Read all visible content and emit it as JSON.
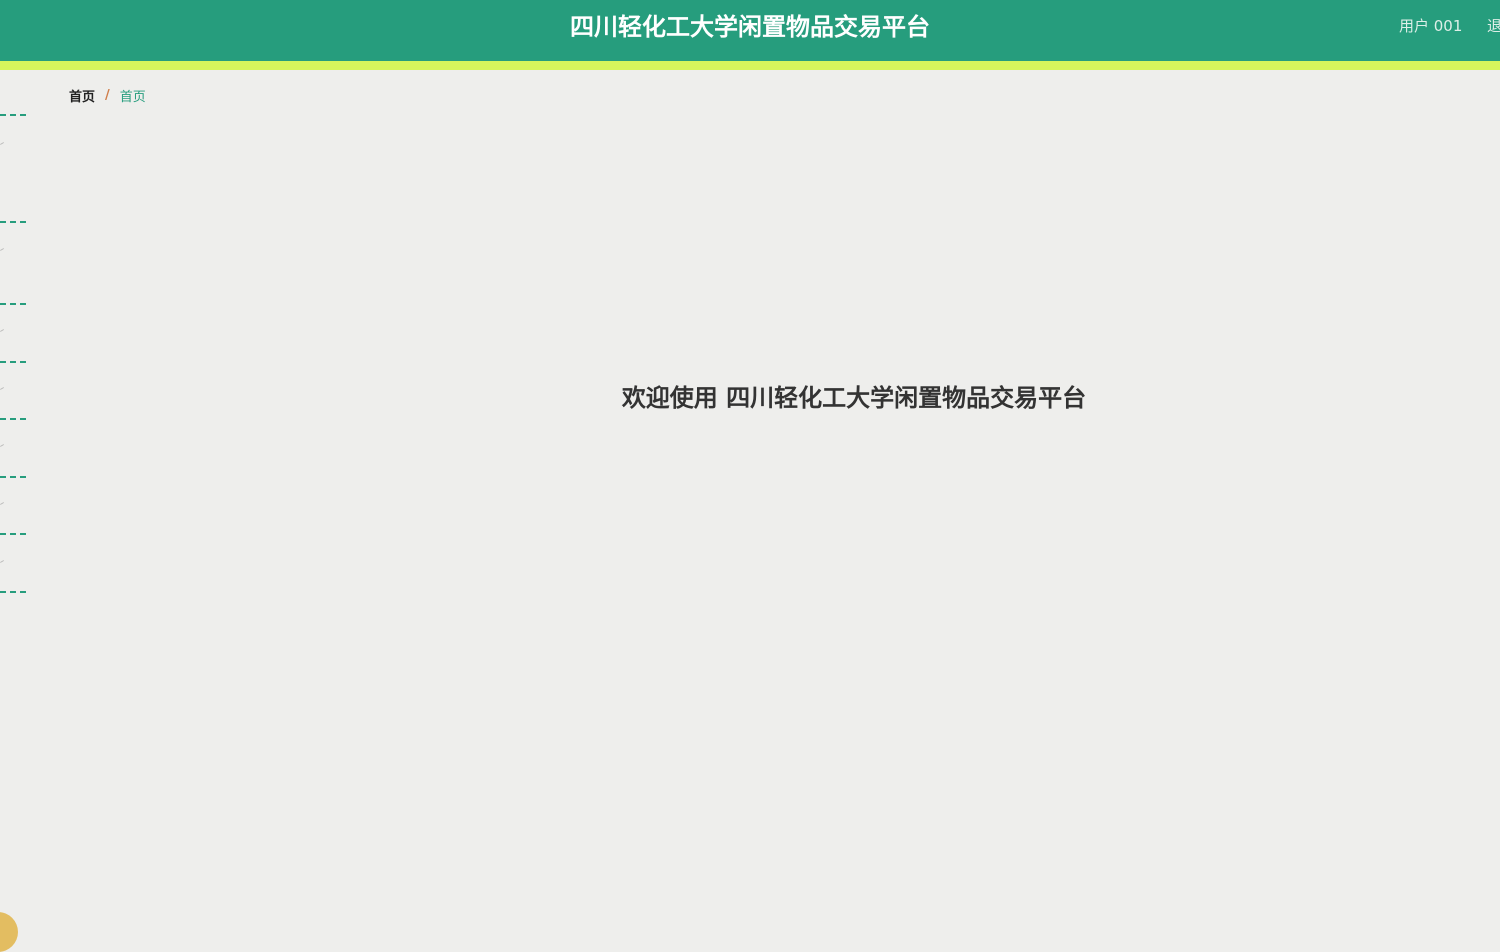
{
  "header": {
    "title": "四川轻化工大学闲置物品交易平台",
    "user_label": "用户 001",
    "logout_label": "退"
  },
  "breadcrumb": {
    "home": "首页",
    "separator": "/",
    "current": "首页"
  },
  "main": {
    "welcome": "欢迎使用 四川轻化工大学闲置物品交易平台"
  },
  "theme": {
    "primary": "#269d7d",
    "accent": "#d6f55c",
    "background": "#eeeeec",
    "fab": "#e3bd61"
  }
}
